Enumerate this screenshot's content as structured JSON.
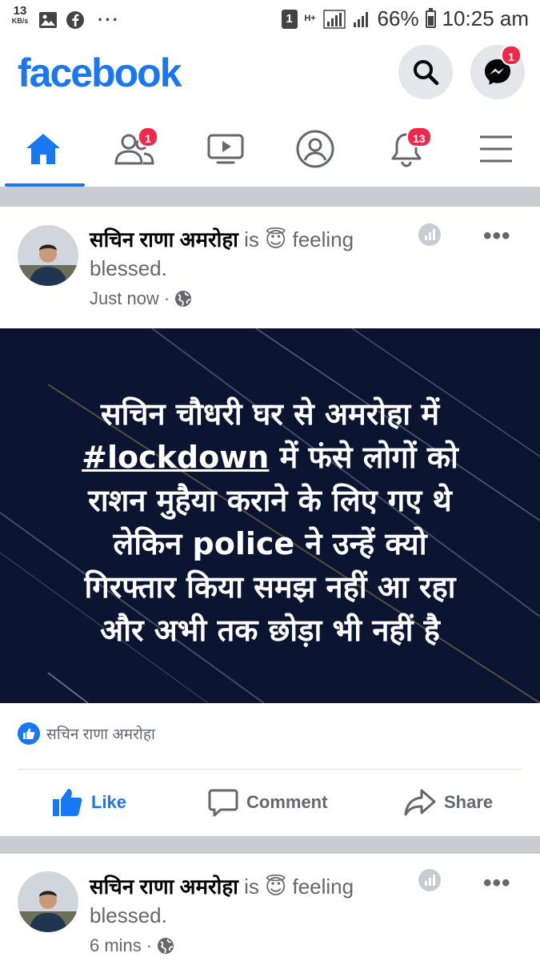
{
  "status_bar": {
    "speed_value": "13",
    "speed_unit": "KB/s",
    "dots": "···",
    "sim": "1",
    "network": "H+",
    "battery": "66%",
    "battery_level": 0.66,
    "time": "10:25 am"
  },
  "header": {
    "logo": "facebook",
    "messenger_badge": "1"
  },
  "nav": {
    "friends_badge": "1",
    "notifications_badge": "13"
  },
  "post1": {
    "author": "सचिन राणा अमरोहा",
    "activity_prefix": " is ",
    "feeling_emoji": "😇",
    "feeling": " feeling blessed.",
    "time": "Just now",
    "more": "•••",
    "image_text": {
      "line1": "सचिन चौधरी घर से अमरोहा में",
      "hashtag": "#lockdown",
      "line2_rest": " में फंसे लोगों को",
      "line3": "राशन मुहैया कराने के लिए गए थे",
      "line4": "लेकिन police ने उन्हें क्यो",
      "line5": "गिरफ्तार किया समझ नहीं आ रहा",
      "line6": "और अभी तक छोड़ा भी नहीं है"
    },
    "reaction_name": "सचिन राणा अमरोहा",
    "actions": {
      "like": "Like",
      "comment": "Comment",
      "share": "Share"
    }
  },
  "post2": {
    "author": "सचिन राणा अमरोहा",
    "activity_prefix": " is ",
    "feeling_emoji": "😇",
    "feeling": " feeling blessed.",
    "time": "6 mins",
    "more": "•••"
  },
  "colors": {
    "brand": "#1877f2",
    "badge": "#f02849",
    "image_bg": "#0b1430"
  }
}
